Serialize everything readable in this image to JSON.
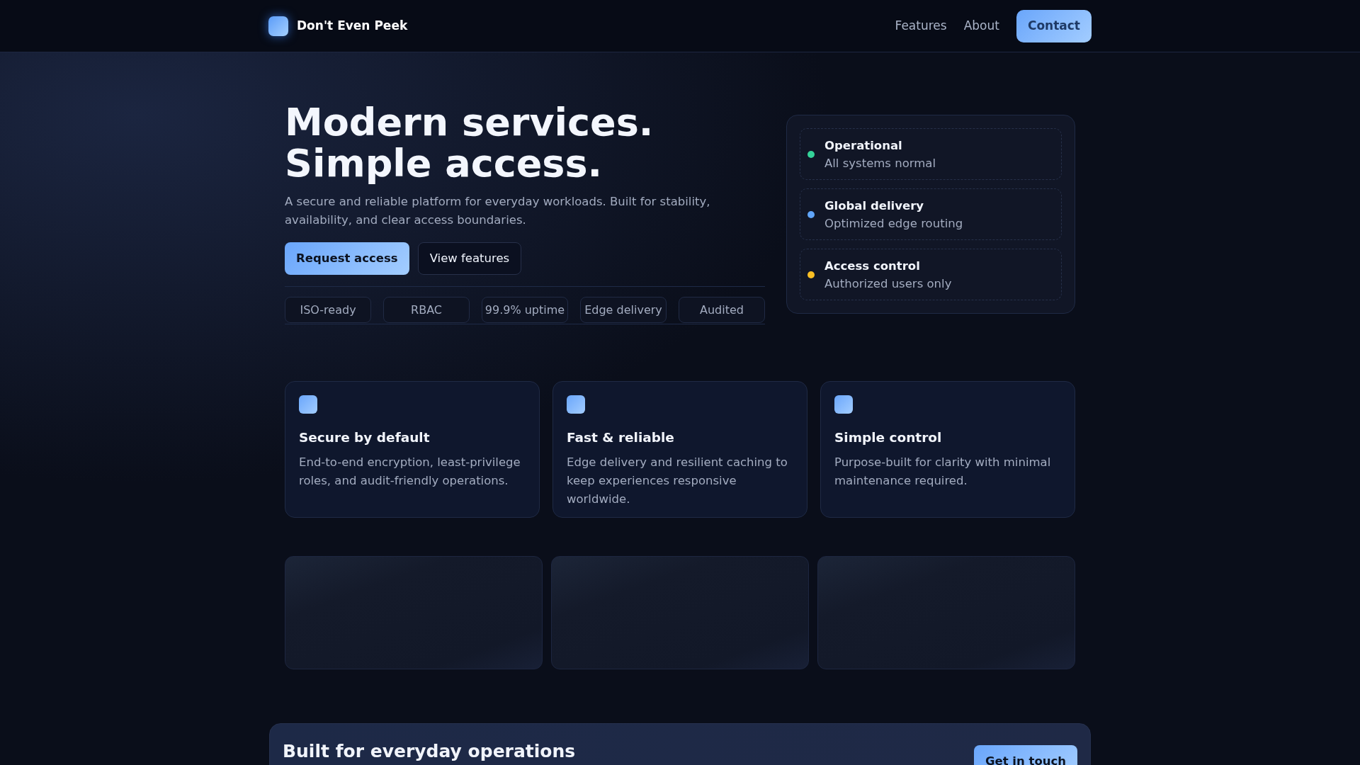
{
  "header": {
    "brand": "Don't Even Peek",
    "nav": [
      "Features",
      "About"
    ],
    "cta": "Contact"
  },
  "hero": {
    "title_lines": [
      "Modern services.",
      "Simple access."
    ],
    "description": "A secure and reliable platform for everyday workloads. Built for stability, availability, and clear access boundaries.",
    "buttons": [
      {
        "label": "Request access",
        "kind": "primary"
      },
      {
        "label": "View features",
        "kind": "secondary"
      }
    ],
    "pills": [
      "ISO-ready",
      "RBAC",
      "99.9% uptime",
      "Edge delivery",
      "Audited"
    ]
  },
  "status": [
    {
      "title": "Operational",
      "subtitle": "All systems normal",
      "color": "#34d399"
    },
    {
      "title": "Global delivery",
      "subtitle": "Optimized edge routing",
      "color": "#60a5fa"
    },
    {
      "title": "Access control",
      "subtitle": "Authorized users only",
      "color": "#fbbf24"
    }
  ],
  "features": [
    {
      "title": "Secure by default",
      "text": "End-to-end encryption, least-privilege roles, and audit-friendly operations."
    },
    {
      "title": "Fast & reliable",
      "text": "Edge delivery and resilient caching to keep experiences responsive worldwide."
    },
    {
      "title": "Simple control",
      "text": "Purpose-built for clarity with minimal maintenance required."
    }
  ],
  "cta_band": {
    "title": "Built for everyday operations",
    "button": "Get in touch"
  }
}
